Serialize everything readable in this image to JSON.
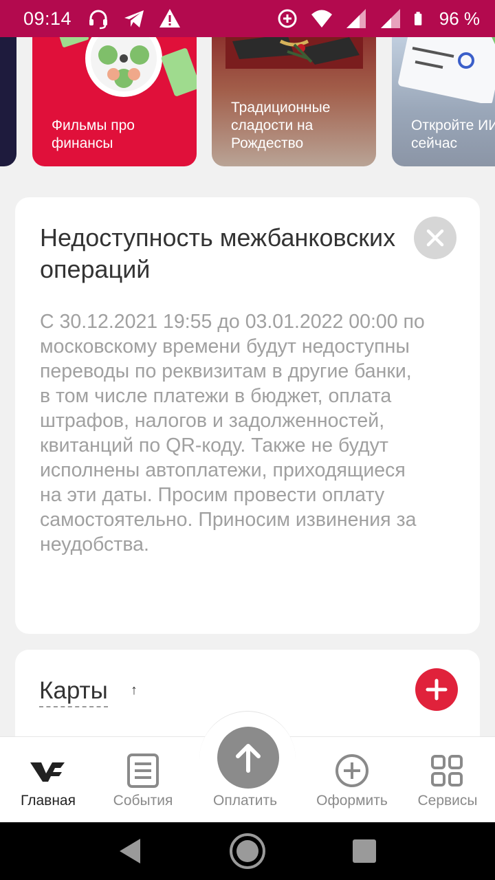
{
  "status_bar": {
    "time": "09:14",
    "battery_pct": "96 %",
    "left_icons": [
      "headset-icon",
      "telegram-icon",
      "warning-icon"
    ],
    "right_icons": [
      "data-saver-icon",
      "wifi-icon",
      "signal-icon",
      "signal-icon",
      "battery-icon"
    ],
    "background": "#b30a4e"
  },
  "stories": [
    {
      "caption": ""
    },
    {
      "caption": "Фильмы про финансы"
    },
    {
      "caption": " Традиционные сладости на Рождество"
    },
    {
      "caption": "Откройте ИИ сейчас"
    }
  ],
  "notice": {
    "title": "Недоступность межбанковских операций",
    "body": "С 30.12.2021 19:55 до 03.01.2022 00:00 по московскому времени будут недоступны переводы по реквизитам в другие банки, в том числе платежи в бюджет, оплата штрафов, налогов и задолженностей, квитанций по QR-коду. Также не будут исполнены автоплатежи, приходящиеся на эти даты. Просим провести оплату самостоятельно. Приносим извинения за неудобства.",
    "close_icon": "close-icon"
  },
  "cards_section": {
    "title": "Карты",
    "sort_icon": "↑",
    "add_icon": "plus-icon",
    "accent": "#e0223b"
  },
  "bottom_nav": {
    "items": [
      {
        "label": "Главная",
        "icon": "home-logo-icon",
        "active": true
      },
      {
        "label": "События",
        "icon": "events-icon",
        "active": false
      },
      {
        "label": "Оплатить",
        "icon": "pay-arrow-icon",
        "active": false
      },
      {
        "label": "Оформить",
        "icon": "plus-circle-icon",
        "active": false
      },
      {
        "label": "Сервисы",
        "icon": "grid-icon",
        "active": false
      }
    ]
  },
  "system_nav": [
    "back-icon",
    "home-icon",
    "recents-icon"
  ]
}
